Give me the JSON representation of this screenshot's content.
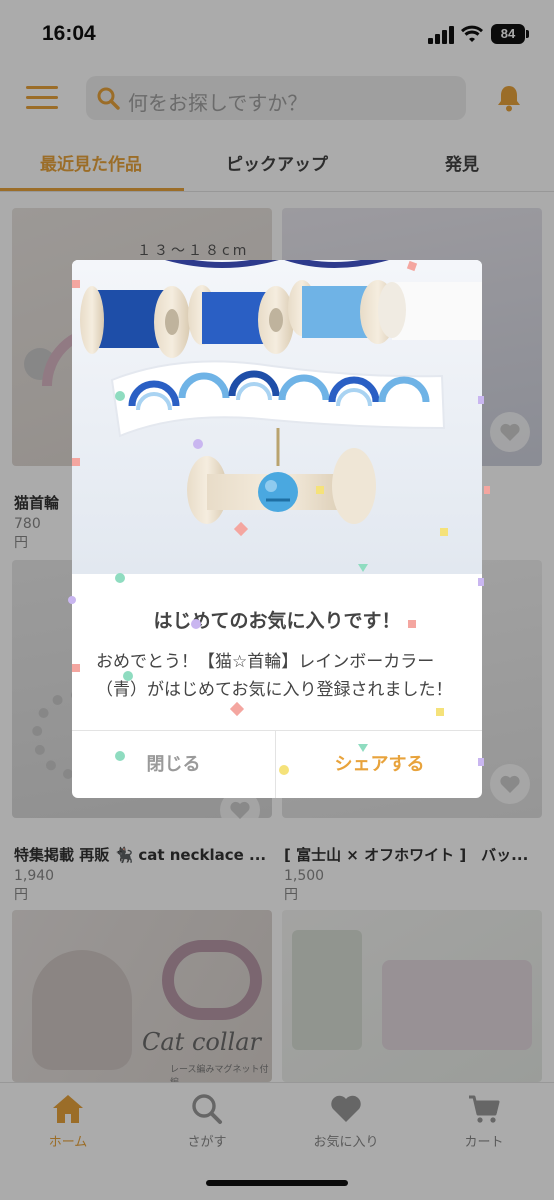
{
  "status": {
    "time": "16:04",
    "battery": "84"
  },
  "header": {
    "search_placeholder": "何をお探しですか？"
  },
  "tabs": [
    {
      "label": "最近見た作品"
    },
    {
      "label": "ピックアップ"
    },
    {
      "label": "発見"
    }
  ],
  "cards": [
    {
      "title": "猫首輪",
      "price": "780円",
      "img_text": "１３～１８cm"
    },
    {
      "title": "",
      "price": ""
    },
    {
      "title": "特集掲載 再販 🐈‍⬛ cat necklace ...",
      "price": "1,940円"
    },
    {
      "title": "[ 富士山 × オフホワイト ]　バッ...",
      "price": "1,500円"
    },
    {
      "title": "",
      "price": "",
      "img_text": "Cat collar",
      "img_sub": "レース編みマグネット付編"
    },
    {
      "title": "",
      "price": ""
    }
  ],
  "modal": {
    "title": "はじめてのお気に入りです！",
    "body": "おめでとう！【猫☆首輪】レインボーカラー（青）がはじめてお気に入り登録されました！",
    "close_label": "閉じる",
    "share_label": "シェアする"
  },
  "nav": [
    {
      "label": "ホーム",
      "icon": "home-icon"
    },
    {
      "label": "さがす",
      "icon": "search-icon"
    },
    {
      "label": "お気に入り",
      "icon": "heart-icon"
    },
    {
      "label": "カート",
      "icon": "cart-icon"
    }
  ],
  "colors": {
    "accent": "#e8a33c",
    "overlay": "rgba(0,0,0,0.33)"
  }
}
